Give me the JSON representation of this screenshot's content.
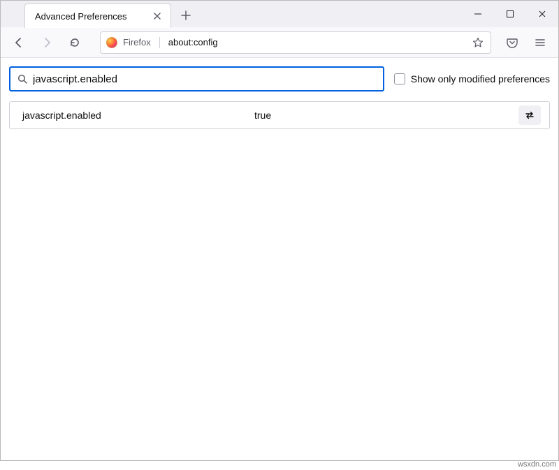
{
  "tab": {
    "title": "Advanced Preferences"
  },
  "address": {
    "brand": "Firefox",
    "url": "about:config"
  },
  "search": {
    "value": "javascript.enabled"
  },
  "filter": {
    "show_only_modified_label": "Show only modified preferences"
  },
  "results": [
    {
      "name": "javascript.enabled",
      "value": "true"
    }
  ],
  "watermark": "wsxdn.com"
}
